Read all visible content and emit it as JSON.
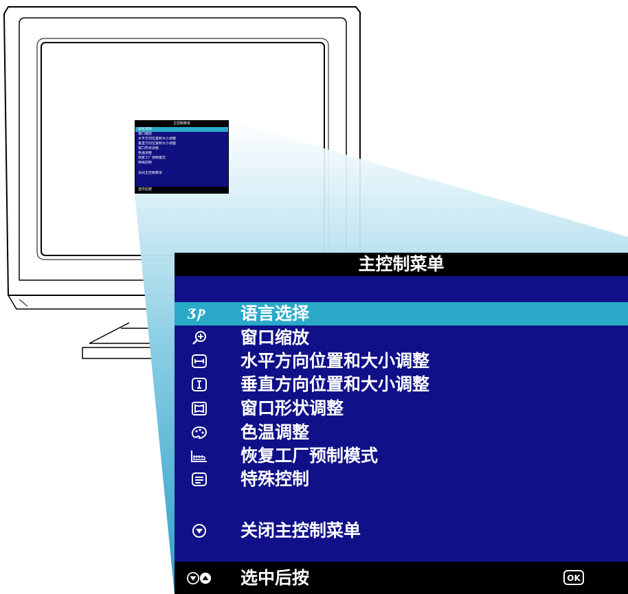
{
  "mini_osd": {
    "title": "主控制菜单",
    "items": [
      "语言选择",
      "窗口缩放",
      "水平方向位置和大小调整",
      "垂直方向位置和大小调整",
      "窗口形状调整",
      "色温调整",
      "恢复工厂预制模式",
      "特殊控制"
    ],
    "close": "关闭主控制菜单",
    "footer": "选中后按"
  },
  "osd": {
    "title": "主控制菜单",
    "items": [
      {
        "icon": "language-icon",
        "label": "语言选择",
        "selected": true
      },
      {
        "icon": "zoom-icon",
        "label": "窗口缩放",
        "selected": false
      },
      {
        "icon": "horizontal-size-icon",
        "label": "水平方向位置和大小调整",
        "selected": false
      },
      {
        "icon": "vertical-size-icon",
        "label": "垂直方向位置和大小调整",
        "selected": false
      },
      {
        "icon": "geometry-icon",
        "label": "窗口形状调整",
        "selected": false
      },
      {
        "icon": "palette-icon",
        "label": "色温调整",
        "selected": false
      },
      {
        "icon": "factory-reset-icon",
        "label": "恢复工厂预制模式",
        "selected": false
      },
      {
        "icon": "special-control-icon",
        "label": "特殊控制",
        "selected": false
      }
    ],
    "close": {
      "icon": "down-arrow-icon",
      "label": "关闭主控制菜单"
    },
    "footer": {
      "icon": "up-down-arrows-icon",
      "label": "选中后按",
      "key_icon": "ok-key-icon"
    },
    "colors": {
      "background": "#101088",
      "highlight": "#2aaac8",
      "bar": "#000000"
    }
  }
}
